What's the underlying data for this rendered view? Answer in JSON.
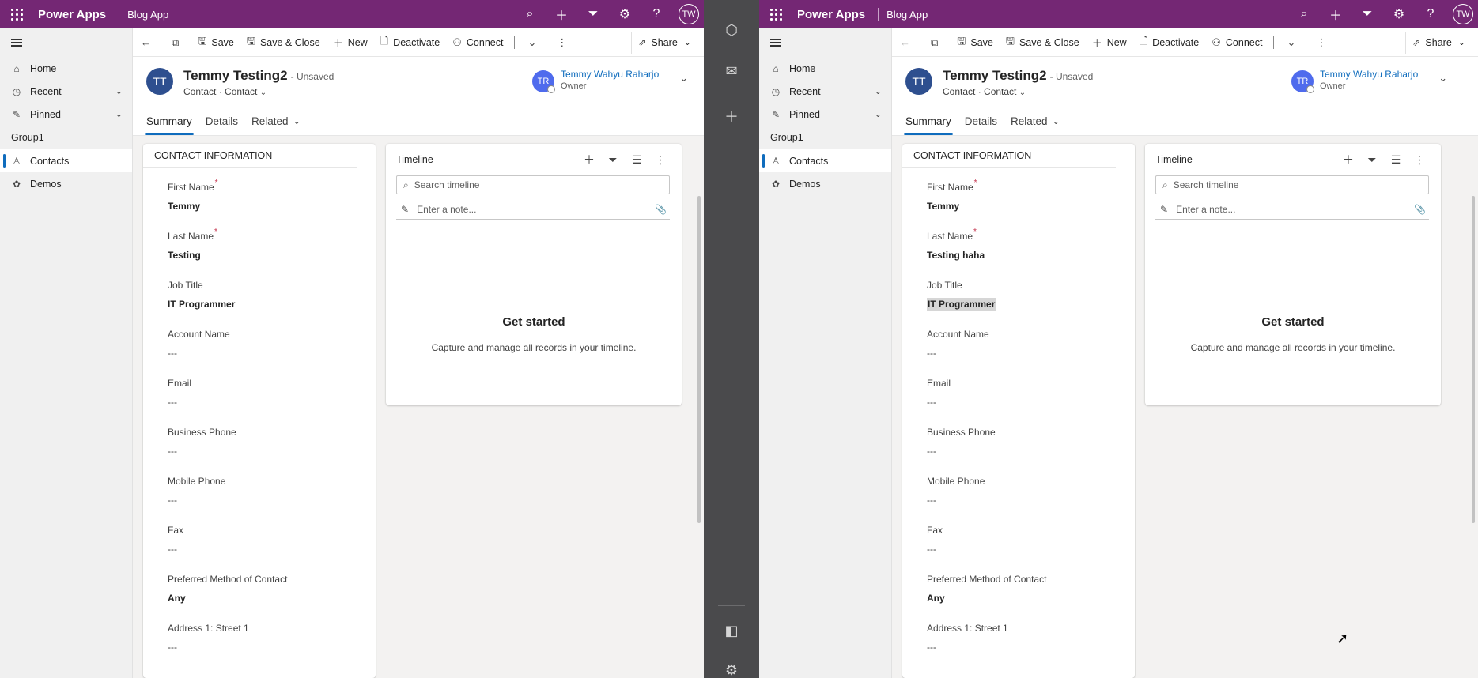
{
  "topbar": {
    "brand": "Power Apps",
    "app_name": "Blog App",
    "avatar_initials": "TW"
  },
  "nav": {
    "items": [
      {
        "label": "Home",
        "icon": "home-icon"
      },
      {
        "label": "Recent",
        "icon": "clock-icon"
      },
      {
        "label": "Pinned",
        "icon": "pin-icon"
      }
    ],
    "group_label": "Group1",
    "entities": [
      {
        "label": "Contacts",
        "icon": "person-icon",
        "active": true
      },
      {
        "label": "Demos",
        "icon": "puzzle-icon",
        "active": false
      }
    ]
  },
  "commandbar": {
    "save": "Save",
    "save_close": "Save & Close",
    "new": "New",
    "deactivate": "Deactivate",
    "connect": "Connect",
    "share": "Share"
  },
  "record": {
    "avatar_initials": "TT",
    "title": "Temmy Testing2",
    "status": "- Unsaved",
    "entity": "Contact",
    "form": "Contact",
    "owner_name": "Temmy Wahyu Raharjo",
    "owner_initials": "TR",
    "owner_role": "Owner"
  },
  "tabs": [
    "Summary",
    "Details",
    "Related"
  ],
  "section_title": "CONTACT INFORMATION",
  "labels": {
    "first_name": "First Name",
    "last_name": "Last Name",
    "job_title": "Job Title",
    "account_name": "Account Name",
    "email": "Email",
    "business_phone": "Business Phone",
    "mobile_phone": "Mobile Phone",
    "fax": "Fax",
    "preferred_contact": "Preferred Method of Contact",
    "address_street1": "Address 1: Street 1"
  },
  "left_values": {
    "first_name": "Temmy",
    "last_name": "Testing",
    "job_title": "IT Programmer",
    "account_name": "---",
    "email": "---",
    "business_phone": "---",
    "mobile_phone": "---",
    "fax": "---",
    "preferred_contact": "Any",
    "address_street1": "---"
  },
  "right_values": {
    "first_name": "Temmy",
    "last_name": "Testing haha",
    "job_title": "IT Programmer",
    "account_name": "---",
    "email": "---",
    "business_phone": "---",
    "mobile_phone": "---",
    "fax": "---",
    "preferred_contact": "Any",
    "address_street1": "---"
  },
  "timeline": {
    "title": "Timeline",
    "search_placeholder": "Search timeline",
    "note_placeholder": "Enter a note...",
    "empty_title": "Get started",
    "empty_caption": "Capture and manage all records in your timeline."
  },
  "colors": {
    "topbar": "#742774",
    "accent": "#0f6cbd",
    "divider": "#4a4a4c"
  }
}
